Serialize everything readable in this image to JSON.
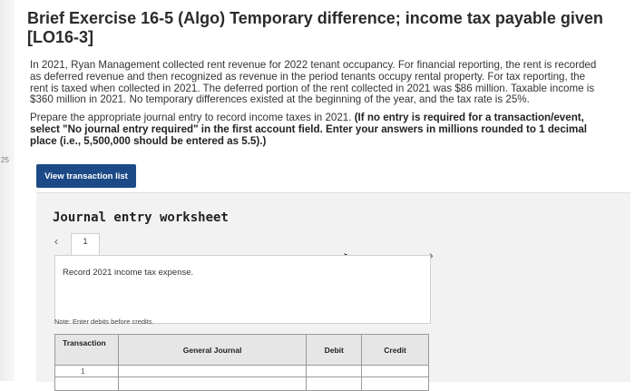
{
  "header": {
    "title": "Brief Exercise 16-5 (Algo) Temporary difference; income tax payable given [LO16-3]"
  },
  "gutter": {
    "mark": "25"
  },
  "problem": {
    "paragraph1": "In 2021, Ryan Management collected rent revenue for 2022 tenant occupancy. For financial reporting, the rent is recorded as deferred revenue and then recognized as revenue in the period tenants occupy rental property. For tax reporting, the rent is taxed when collected in 2021. The deferred portion of the rent collected in 2021 was $86 million. Taxable income is $360 million in 2021. No temporary differences existed at the beginning of the year, and the tax rate is 25%.",
    "paragraph2_plain": "Prepare the appropriate journal entry to record income taxes in 2021. ",
    "paragraph2_bold": "(If no entry is required for a transaction/event, select \"No journal entry required\" in the first account field. Enter your answers in millions rounded to 1 decimal place (i.e., 5,500,000 should be entered as 5.5).)"
  },
  "toolbar": {
    "view_transaction_label": "View transaction list"
  },
  "worksheet": {
    "title": "Journal entry worksheet",
    "prev_icon": "‹",
    "next_icon": "›",
    "tab_label": "1",
    "prompt": "Record 2021 income tax expense.",
    "note": "Note: Enter debits before credits.",
    "table": {
      "headers": [
        "Transaction",
        "General Journal",
        "Debit",
        "Credit"
      ],
      "rows": [
        {
          "transaction": "1"
        }
      ]
    }
  }
}
